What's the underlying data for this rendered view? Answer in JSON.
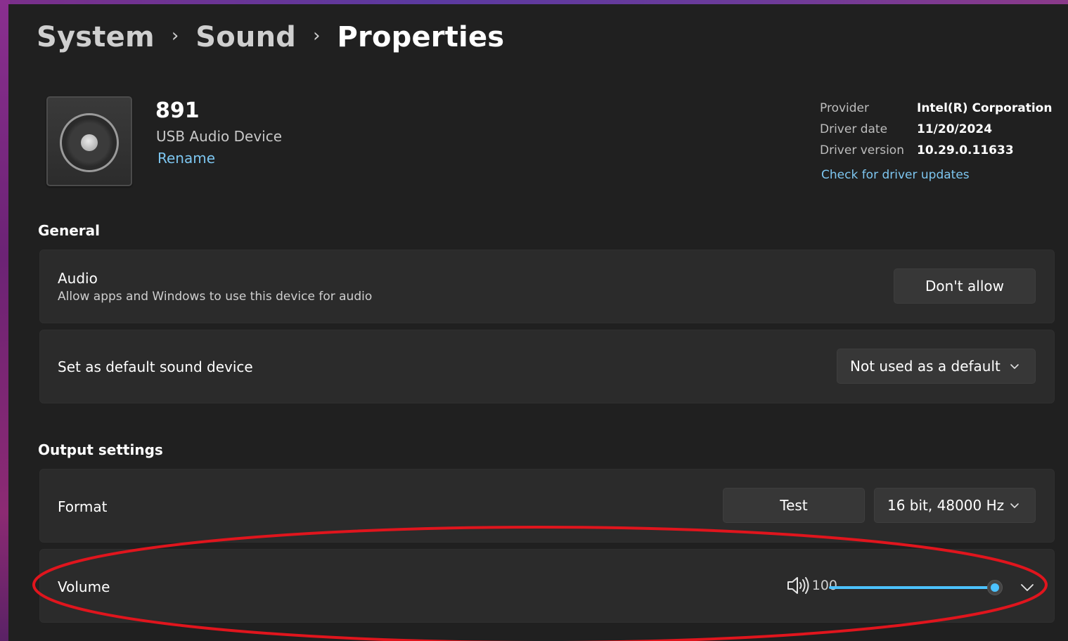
{
  "breadcrumb": {
    "items": [
      "System",
      "Sound",
      "Properties"
    ],
    "separator": "›"
  },
  "device": {
    "name": "891",
    "subtitle": "USB Audio Device",
    "rename_label": "Rename",
    "icon": "speaker-icon"
  },
  "driver": {
    "provider_label": "Provider",
    "provider_value": "Intel(R) Corporation",
    "date_label": "Driver date",
    "date_value": "11/20/2024",
    "version_label": "Driver version",
    "version_value": "10.29.0.11633",
    "update_link": "Check for driver updates"
  },
  "general": {
    "title": "General",
    "audio": {
      "title": "Audio",
      "description": "Allow apps and Windows to use this device for audio",
      "button_label": "Don't allow"
    },
    "default_device": {
      "title": "Set as default sound device",
      "selected": "Not used as a default"
    }
  },
  "output": {
    "title": "Output settings",
    "format": {
      "title": "Format",
      "test_label": "Test",
      "selected": "16 bit, 48000 Hz"
    },
    "volume": {
      "title": "Volume",
      "value": "100",
      "level": 1.0
    }
  },
  "colors": {
    "accent": "#4cc2ff",
    "link": "#7dc6f0",
    "card": "#2b2b2b",
    "background": "#202020",
    "annotation": "#e0151d"
  }
}
